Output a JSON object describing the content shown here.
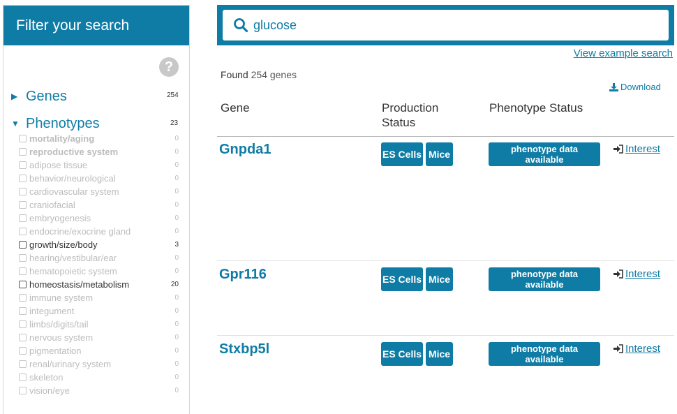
{
  "sidebar": {
    "title": "Filter your search",
    "help_icon": "question-circle-icon",
    "genes": {
      "label": "Genes",
      "count": "254",
      "expanded": false
    },
    "phenotypes": {
      "label": "Phenotypes",
      "count": "23",
      "expanded": true
    },
    "facets": [
      {
        "label": "mortality/aging",
        "count": "0",
        "bold": true,
        "active": false
      },
      {
        "label": "reproductive system",
        "count": "0",
        "bold": true,
        "active": false
      },
      {
        "label": "adipose tissue",
        "count": "0",
        "bold": false,
        "active": false
      },
      {
        "label": "behavior/neurological",
        "count": "0",
        "bold": false,
        "active": false
      },
      {
        "label": "cardiovascular system",
        "count": "0",
        "bold": false,
        "active": false
      },
      {
        "label": "craniofacial",
        "count": "0",
        "bold": false,
        "active": false
      },
      {
        "label": "embryogenesis",
        "count": "0",
        "bold": false,
        "active": false
      },
      {
        "label": "endocrine/exocrine gland",
        "count": "0",
        "bold": false,
        "active": false
      },
      {
        "label": "growth/size/body",
        "count": "3",
        "bold": false,
        "active": true
      },
      {
        "label": "hearing/vestibular/ear",
        "count": "0",
        "bold": false,
        "active": false
      },
      {
        "label": "hematopoietic system",
        "count": "0",
        "bold": false,
        "active": false
      },
      {
        "label": "homeostasis/metabolism",
        "count": "20",
        "bold": false,
        "active": true
      },
      {
        "label": "immune system",
        "count": "0",
        "bold": false,
        "active": false
      },
      {
        "label": "integument",
        "count": "0",
        "bold": false,
        "active": false
      },
      {
        "label": "limbs/digits/tail",
        "count": "0",
        "bold": false,
        "active": false
      },
      {
        "label": "nervous system",
        "count": "0",
        "bold": false,
        "active": false
      },
      {
        "label": "pigmentation",
        "count": "0",
        "bold": false,
        "active": false
      },
      {
        "label": "renal/urinary system",
        "count": "0",
        "bold": false,
        "active": false
      },
      {
        "label": "skeleton",
        "count": "0",
        "bold": false,
        "active": false
      },
      {
        "label": "vision/eye",
        "count": "0",
        "bold": false,
        "active": false
      }
    ]
  },
  "search": {
    "value": "glucose",
    "example_link": "View example search"
  },
  "results": {
    "found_prefix": "Found",
    "found_count": "254 genes",
    "download_label": "Download",
    "columns": {
      "gene": "Gene",
      "production_line1": "Production",
      "production_line2": "Status",
      "phenotype": "Phenotype Status"
    },
    "rows": [
      {
        "gene": "Gnpda1",
        "es": "ES Cells",
        "mice": "Mice",
        "pheno_line1": "phenotype data",
        "pheno_line2": "available",
        "interest": "Interest"
      },
      {
        "gene": "Gpr116",
        "es": "ES Cells",
        "mice": "Mice",
        "pheno_line1": "phenotype data",
        "pheno_line2": "available",
        "interest": "Interest"
      },
      {
        "gene": "Stxbp5l",
        "es": "ES Cells",
        "mice": "Mice",
        "pheno_line1": "phenotype data",
        "pheno_line2": "available",
        "interest": "Interest"
      }
    ]
  },
  "colors": {
    "accent": "#0f7ca6",
    "muted": "#bcbcbc"
  }
}
